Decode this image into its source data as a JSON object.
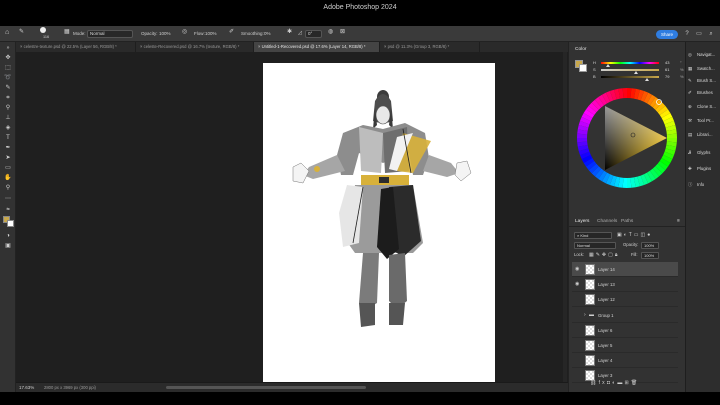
{
  "app": {
    "title": "Adobe Photoshop 2024"
  },
  "options_bar": {
    "brush_size": "116",
    "mode_label": "Mode:",
    "mode_value": "Normal",
    "opacity_label": "Opacity:",
    "opacity_value": "100%",
    "flow_label": "Flow:",
    "flow_value": "100%",
    "smoothing_label": "Smoothing:",
    "smoothing_value": "0%",
    "angle_value": "0°",
    "share_label": "Share"
  },
  "tabs": [
    {
      "label": "celestre-texture.psd @ 22.5% (Layer 56, RGB/8) *",
      "active": false
    },
    {
      "label": "celeste-Recovered.psd @ 16.7% (texture, RGB/8) *",
      "active": false
    },
    {
      "label": "Untitled-1-Recovered.psd @ 17.6% (Layer 14, RGB/8) *",
      "active": true
    },
    {
      "label": "psd @ 11.3% (Group 3, RGB/8) *",
      "active": false
    }
  ],
  "status": {
    "zoom": "17.63%",
    "info": "2800 px x 3969 px (300 ppi)"
  },
  "color_panel": {
    "title": "Color",
    "fg_color": "#c8a84b",
    "sliders": [
      {
        "label": "H",
        "value": "43",
        "unit": "°",
        "pos": 0.12
      },
      {
        "label": "S",
        "value": "61",
        "unit": "%",
        "pos": 0.61
      },
      {
        "label": "B",
        "value": "79",
        "unit": "%",
        "pos": 0.79
      }
    ]
  },
  "layers_panel": {
    "tabs": [
      "Layers",
      "Channels",
      "Paths"
    ],
    "filter_label": "Kind",
    "blend_mode": "Normal",
    "opacity_label": "Opacity:",
    "opacity_value": "100%",
    "lock_label": "Lock:",
    "fill_label": "Fill:",
    "fill_value": "100%",
    "layers": [
      {
        "name": "Layer 14",
        "visible": true,
        "selected": true,
        "type": "layer"
      },
      {
        "name": "Layer 13",
        "visible": true,
        "selected": false,
        "type": "layer"
      },
      {
        "name": "Layer 12",
        "visible": false,
        "selected": false,
        "type": "layer"
      },
      {
        "name": "Group 1",
        "visible": false,
        "selected": false,
        "type": "group"
      },
      {
        "name": "Layer 6",
        "visible": false,
        "selected": false,
        "type": "layer"
      },
      {
        "name": "Layer 5",
        "visible": false,
        "selected": false,
        "type": "layer"
      },
      {
        "name": "Layer 4",
        "visible": false,
        "selected": false,
        "type": "layer"
      },
      {
        "name": "Layer 3",
        "visible": false,
        "selected": false,
        "type": "layer"
      }
    ]
  },
  "right_panels": [
    {
      "label": "Navigat...",
      "icon": "navigator-icon"
    },
    {
      "label": "Swatch...",
      "icon": "swatches-icon"
    },
    {
      "label": "Brush S...",
      "icon": "brush-settings-icon"
    },
    {
      "label": "Brushes",
      "icon": "brushes-icon"
    },
    {
      "label": "Clone S...",
      "icon": "clone-source-icon"
    },
    {
      "label": "Tool Pr...",
      "icon": "tool-presets-icon"
    },
    {
      "label": "Librari...",
      "icon": "libraries-icon"
    },
    {
      "label": "Glyphs",
      "icon": "glyphs-icon"
    },
    {
      "label": "Plugins",
      "icon": "plugins-icon"
    },
    {
      "label": "Info",
      "icon": "info-icon"
    }
  ]
}
